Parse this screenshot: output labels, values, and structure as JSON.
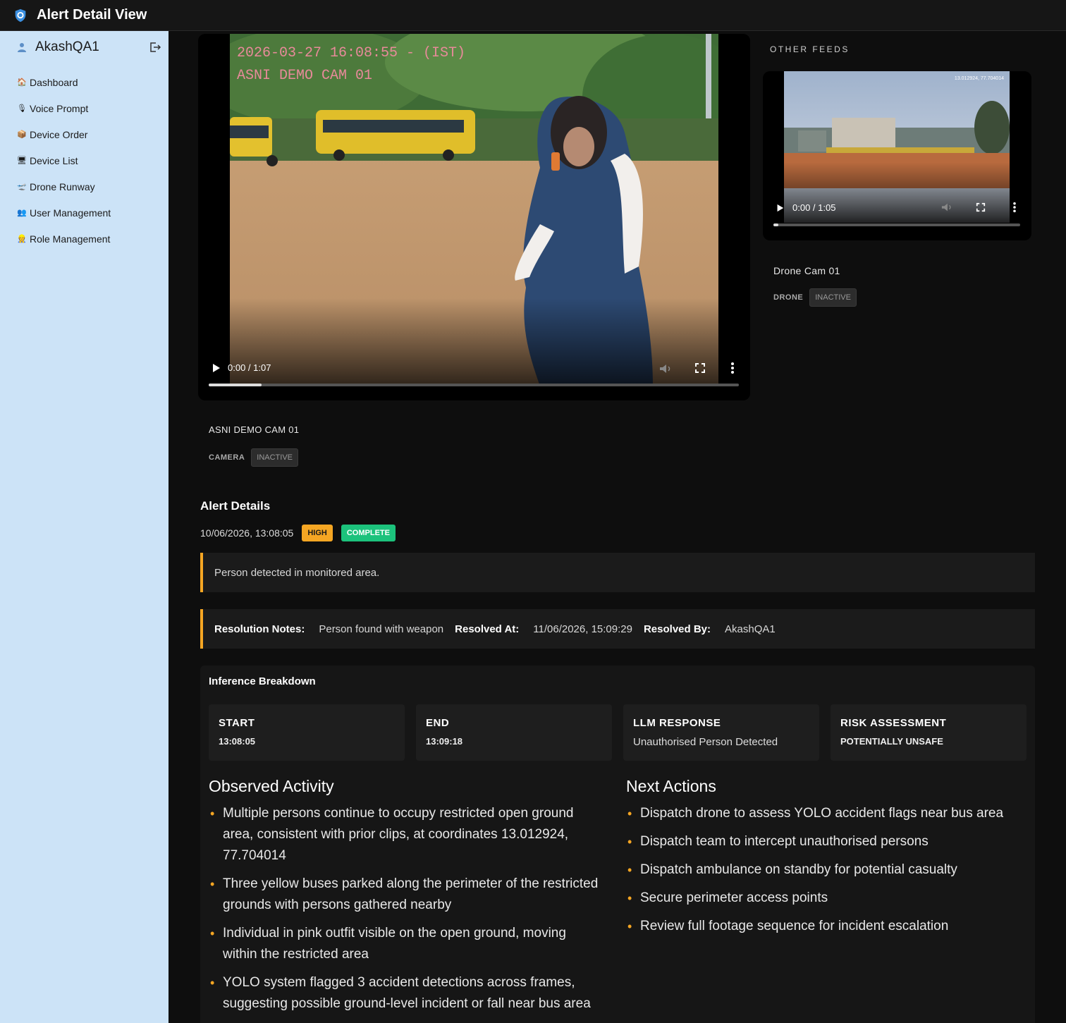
{
  "header": {
    "title": "Alert Detail View"
  },
  "sidebar": {
    "username": "AkashQA1",
    "items": [
      {
        "label": "Dashboard",
        "icon": "house-icon"
      },
      {
        "label": "Voice Prompt",
        "icon": "microphone-icon"
      },
      {
        "label": "Device Order",
        "icon": "package-icon"
      },
      {
        "label": "Device List",
        "icon": "monitor-icon"
      },
      {
        "label": "Drone Runway",
        "icon": "airplane-icon"
      },
      {
        "label": "User Management",
        "icon": "users-icon"
      },
      {
        "label": "Role Management",
        "icon": "role-icon"
      }
    ]
  },
  "main_video": {
    "overlay_line1": "2026-03-27 16:08:55 - (IST)",
    "overlay_line2": "ASNI DEMO CAM 01",
    "time": "0:00 / 1:07",
    "progress": 0.1,
    "camera_name": "ASNI DEMO CAM 01",
    "type": "CAMERA",
    "status": "INACTIVE"
  },
  "other_feeds": {
    "label": "OTHER FEEDS",
    "feed": {
      "coords": "13.012924, 77.704014",
      "time": "0:00 / 1:05",
      "progress": 0.02,
      "name": "Drone Cam 01",
      "type": "DRONE",
      "status": "INACTIVE"
    }
  },
  "alert": {
    "title": "Alert Details",
    "timestamp": "10/06/2026, 13:08:05",
    "severity": "HIGH",
    "state": "COMPLETE",
    "description": "Person detected in monitored area.",
    "resolution_label": "Resolution Notes:",
    "resolution_value": "Person found with weapon",
    "resolved_at_label": "Resolved At:",
    "resolved_at_value": "11/06/2026, 15:09:29",
    "resolved_by_label": "Resolved By:",
    "resolved_by_value": "AkashQA1"
  },
  "inference": {
    "title": "Inference Breakdown",
    "cards": [
      {
        "key": "START",
        "value": "13:08:05"
      },
      {
        "key": "END",
        "value": "13:09:18"
      },
      {
        "key": "LLM RESPONSE",
        "value": "Unauthorised Person Detected"
      },
      {
        "key": "RISK ASSESSMENT",
        "value": "POTENTIALLY UNSAFE"
      }
    ],
    "observed_title": "Observed Activity",
    "observed": [
      "Multiple persons continue to occupy restricted open ground area, consistent with prior clips, at coordinates 13.012924, 77.704014",
      "Three yellow buses parked along the perimeter of the restricted grounds with persons gathered nearby",
      "Individual in pink outfit visible on the open ground, moving within the restricted area",
      "YOLO system flagged 3 accident detections across frames, suggesting possible ground-level incident or fall near bus area"
    ],
    "next_title": "Next Actions",
    "next": [
      "Dispatch drone to assess YOLO accident flags near bus area",
      "Dispatch team to intercept unauthorised persons",
      "Dispatch ambulance on standby for potential casualty",
      "Secure perimeter access points",
      "Review full footage sequence for incident escalation"
    ]
  },
  "colors": {
    "accent": "#f5a623",
    "complete": "#1cc27c",
    "sidebar": "#cce3f7"
  }
}
